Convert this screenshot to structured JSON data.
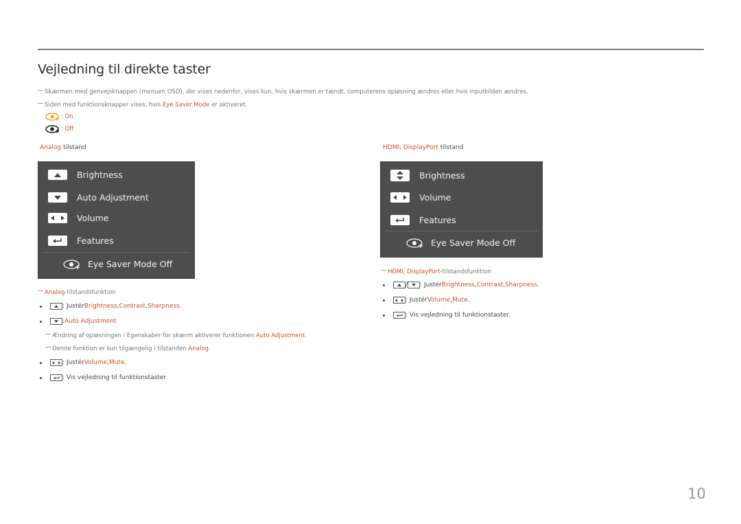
{
  "page": {
    "title": "Vejledning til direkte taster",
    "page_number": "10"
  },
  "notes": {
    "note1": "Skærmen med genvejsknappen (menuen OSD), der vises nedenfor, vises kun, hvis skærmen er tændt, computerens opløsning ændres eller hvis inputkilden ændres.",
    "note2_pre": "Siden med funktionsknapper vises, hvis ",
    "note2_hl": "Eye Saver Mode",
    "note2_post": " er aktiveret.",
    "legend_on": ": On",
    "legend_off": ": Off"
  },
  "analog": {
    "heading_hl": "Analog",
    "heading_rest": " tilstand",
    "panel": {
      "items": [
        {
          "icon": "up-arrow-key",
          "label": "Brightness"
        },
        {
          "icon": "down-arrow-key",
          "label": "Auto Adjustment"
        },
        {
          "icon": "left-right-key",
          "label": "Volume"
        },
        {
          "icon": "enter-key",
          "label": "Features"
        }
      ],
      "eye_saver": "Eye Saver Mode Off"
    },
    "func_note_hl": "Analog",
    "func_note_rest": "-tilstandsfunktion",
    "bullets": {
      "b1_pre": ": Justér ",
      "b1_hl1": "Brightness",
      "b1_sep1": ", ",
      "b1_hl2": "Contrast",
      "b1_sep2": ", ",
      "b1_hl3": "Sharpness",
      "b1_end": ".",
      "b2_pre": ": ",
      "b2_hl": "Auto Adjustment",
      "sub1_pre": "Ændring af opløsningen i Egenskaber for skærm aktiverer funktionen ",
      "sub1_hl": "Auto Adjustment",
      "sub1_end": ".",
      "sub2_pre": "Denne funktion er kun tilgængelig i tilstanden ",
      "sub2_hl": "Analog",
      "sub2_end": ".",
      "b3_pre": ": Justér ",
      "b3_hl1": "Volume",
      "b3_sep": ", ",
      "b3_hl2": "Mute",
      "b3_end": ".",
      "b4": ": Vis vejledning til funktionstaster."
    }
  },
  "hdmi": {
    "heading_hl1": "HDMI",
    "heading_sep": ", ",
    "heading_hl2": "DisplayPort",
    "heading_rest": " tilstand",
    "panel": {
      "items": [
        {
          "icon": "up-down-key",
          "label": "Brightness"
        },
        {
          "icon": "left-right-key",
          "label": "Volume"
        },
        {
          "icon": "enter-key",
          "label": "Features"
        }
      ],
      "eye_saver": "Eye Saver Mode Off"
    },
    "func_note_hl1": "HDMI",
    "func_note_sep": ", ",
    "func_note_hl2": "DisplayPort",
    "func_note_rest": "-tilstandsfunktion",
    "bullets": {
      "b1_slash": "/",
      "b1_pre": ": Justér ",
      "b1_hl1": "Brightness",
      "b1_sep1": ", ",
      "b1_hl2": "Contrast",
      "b1_sep2": ", ",
      "b1_hl3": "Sharpness",
      "b1_end": ".",
      "b2_pre": ": Justér ",
      "b2_hl1": "Volume",
      "b2_sep": ", ",
      "b2_hl2": "Mute",
      "b2_end": ".",
      "b3": ": Vis vejledning til funktionstaster."
    }
  },
  "colors": {
    "accent": "#c8502a",
    "eye_on": "#f5a623",
    "panel_bg": "#4d4d4d"
  }
}
